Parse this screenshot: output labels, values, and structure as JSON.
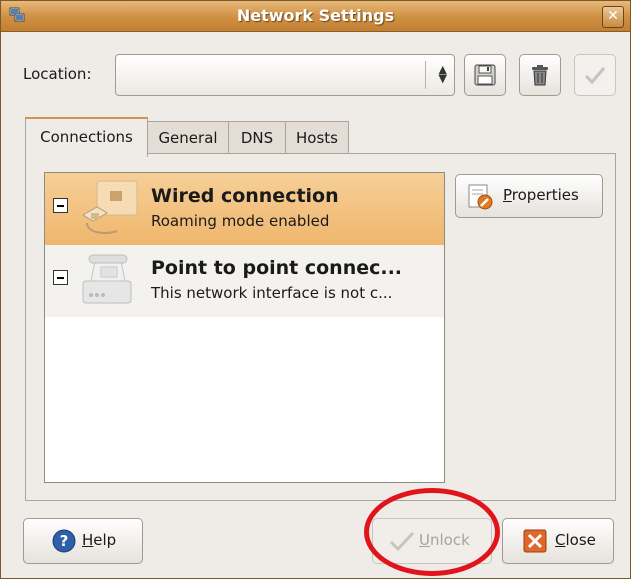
{
  "window": {
    "title": "Network Settings"
  },
  "location": {
    "label": "Location:",
    "value": ""
  },
  "toolbar": {
    "save_icon": "floppy-disk-icon",
    "delete_icon": "trash-can-icon",
    "apply_icon": "check-icon"
  },
  "tabs": [
    {
      "label": "Connections",
      "active": true
    },
    {
      "label": "General",
      "active": false
    },
    {
      "label": "DNS",
      "active": false
    },
    {
      "label": "Hosts",
      "active": false
    }
  ],
  "connections": [
    {
      "name": "Wired connection",
      "status": "Roaming mode enabled",
      "icon": "wired-network-icon",
      "selected": true
    },
    {
      "name": "Point to point connec...",
      "status": "This network interface is not c...",
      "icon": "modem-phone-icon",
      "selected": false
    }
  ],
  "buttons": {
    "properties": "Properties",
    "help": "Help",
    "unlock": "Unlock",
    "close": "Close"
  },
  "colors": {
    "title_bar": "#cf8f42",
    "selection": "#f0b56b",
    "annotation": "#e0141a"
  }
}
